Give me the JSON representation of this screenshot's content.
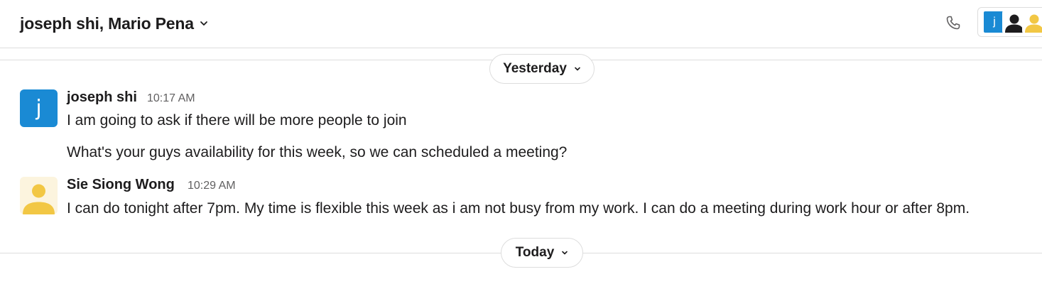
{
  "header": {
    "channel_title": "joseph shi, Mario Pena",
    "phone_icon": "phone-icon",
    "members": [
      {
        "initial": "j",
        "color": "#1a8ad4"
      },
      {
        "icon": "person-dark-icon",
        "color": "#1d1c1d"
      },
      {
        "icon": "person-yellow-icon",
        "color": "#f2c744"
      }
    ]
  },
  "dividers": {
    "yesterday": "Yesterday",
    "today": "Today"
  },
  "messages": [
    {
      "sender": "joseph shi",
      "avatar_initial": "j",
      "avatar_color": "#1a8ad4",
      "time": "10:17 AM",
      "lines": [
        "I am going to ask if there will be more people to join",
        "What's your guys availability for this week, so we can scheduled a meeting?"
      ]
    },
    {
      "sender": "Sie Siong Wong",
      "avatar_color": "#f2c744",
      "time": "10:29 AM",
      "lines": [
        "I can do tonight after 7pm. My time is flexible this week as i am not busy from my work. I can do a meeting during work hour or after 8pm."
      ]
    }
  ]
}
